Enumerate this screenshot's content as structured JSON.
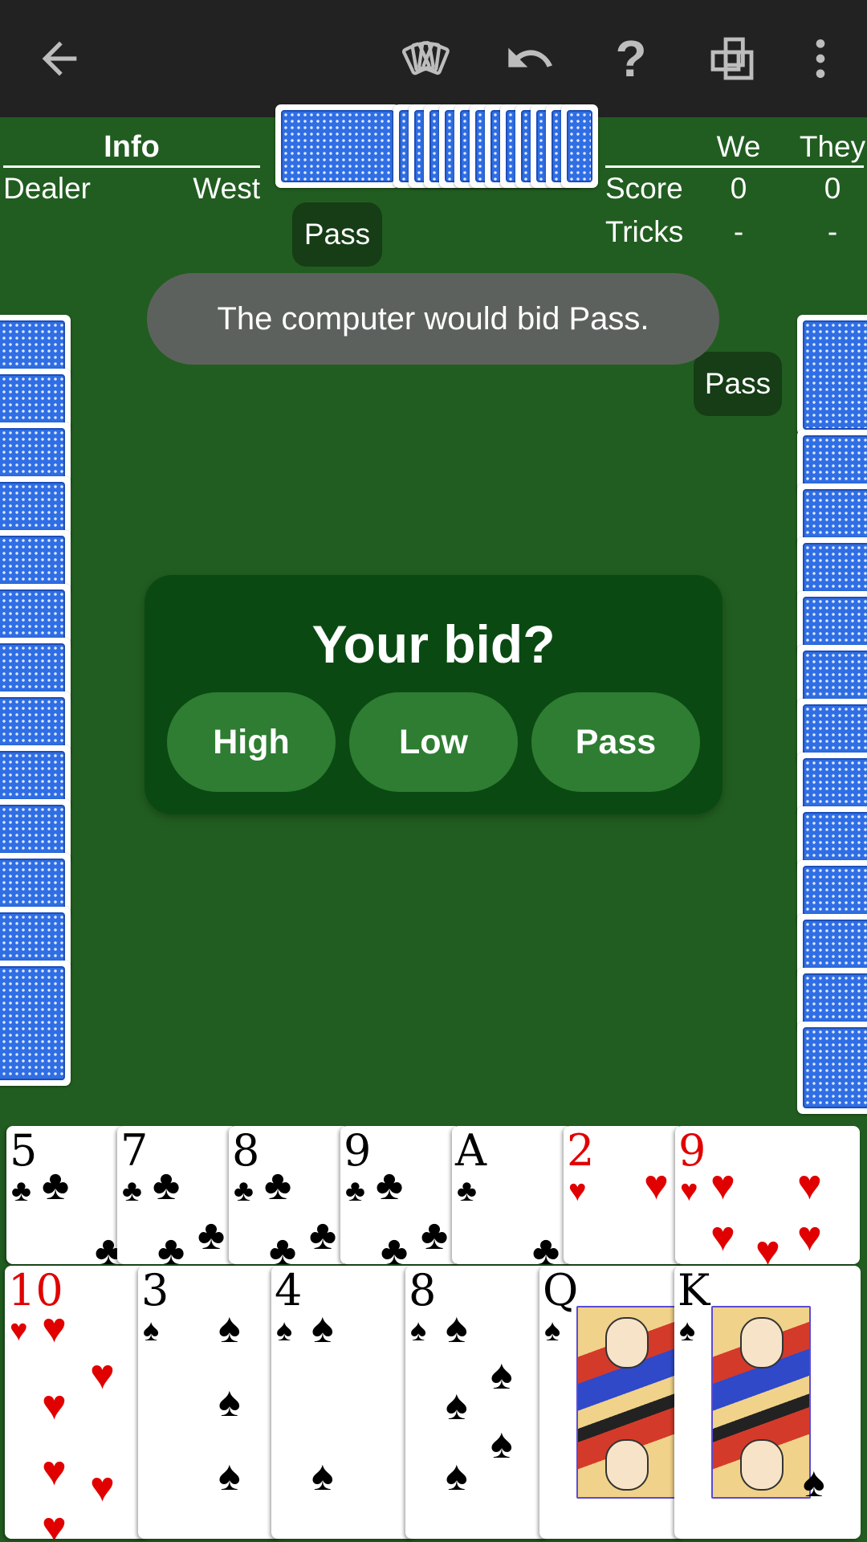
{
  "toolbar": {
    "back_icon": "arrow-left-icon",
    "cards_icon": "cards-fan-icon",
    "undo_icon": "undo-icon",
    "help_icon": "help-icon",
    "layout_icon": "overlapping-squares-icon",
    "more_icon": "more-vertical-icon",
    "help_glyph": "?"
  },
  "info": {
    "title": "Info",
    "dealer_label": "Dealer",
    "dealer_value": "West"
  },
  "score": {
    "col_we": "We",
    "col_they": "They",
    "score_label": "Score",
    "score_we": "0",
    "score_they": "0",
    "tricks_label": "Tricks",
    "tricks_we": "-",
    "tricks_they": "-"
  },
  "bids": {
    "north": "Pass",
    "east": "Pass"
  },
  "toast": "The computer would bid Pass.",
  "dialog": {
    "title": "Your bid?",
    "buttons": [
      "High",
      "Low",
      "Pass"
    ]
  },
  "hand": {
    "row1": [
      {
        "rank": "5",
        "suit": "♣",
        "color": "black"
      },
      {
        "rank": "7",
        "suit": "♣",
        "color": "black"
      },
      {
        "rank": "8",
        "suit": "♣",
        "color": "black"
      },
      {
        "rank": "9",
        "suit": "♣",
        "color": "black"
      },
      {
        "rank": "A",
        "suit": "♣",
        "color": "black"
      },
      {
        "rank": "2",
        "suit": "♥",
        "color": "red"
      },
      {
        "rank": "9",
        "suit": "♥",
        "color": "red"
      }
    ],
    "row2": [
      {
        "rank": "10",
        "suit": "♥",
        "color": "red"
      },
      {
        "rank": "3",
        "suit": "♠",
        "color": "black"
      },
      {
        "rank": "4",
        "suit": "♠",
        "color": "black"
      },
      {
        "rank": "8",
        "suit": "♠",
        "color": "black"
      },
      {
        "rank": "Q",
        "suit": "♠",
        "color": "black"
      },
      {
        "rank": "K",
        "suit": "♠",
        "color": "black"
      }
    ]
  },
  "colors": {
    "felt": "#215d20",
    "toolbar": "#222222",
    "dialog": "#0a4a12",
    "button": "#2e7d32",
    "card_back": "#2f6ee4",
    "red_suit": "#e00000"
  }
}
